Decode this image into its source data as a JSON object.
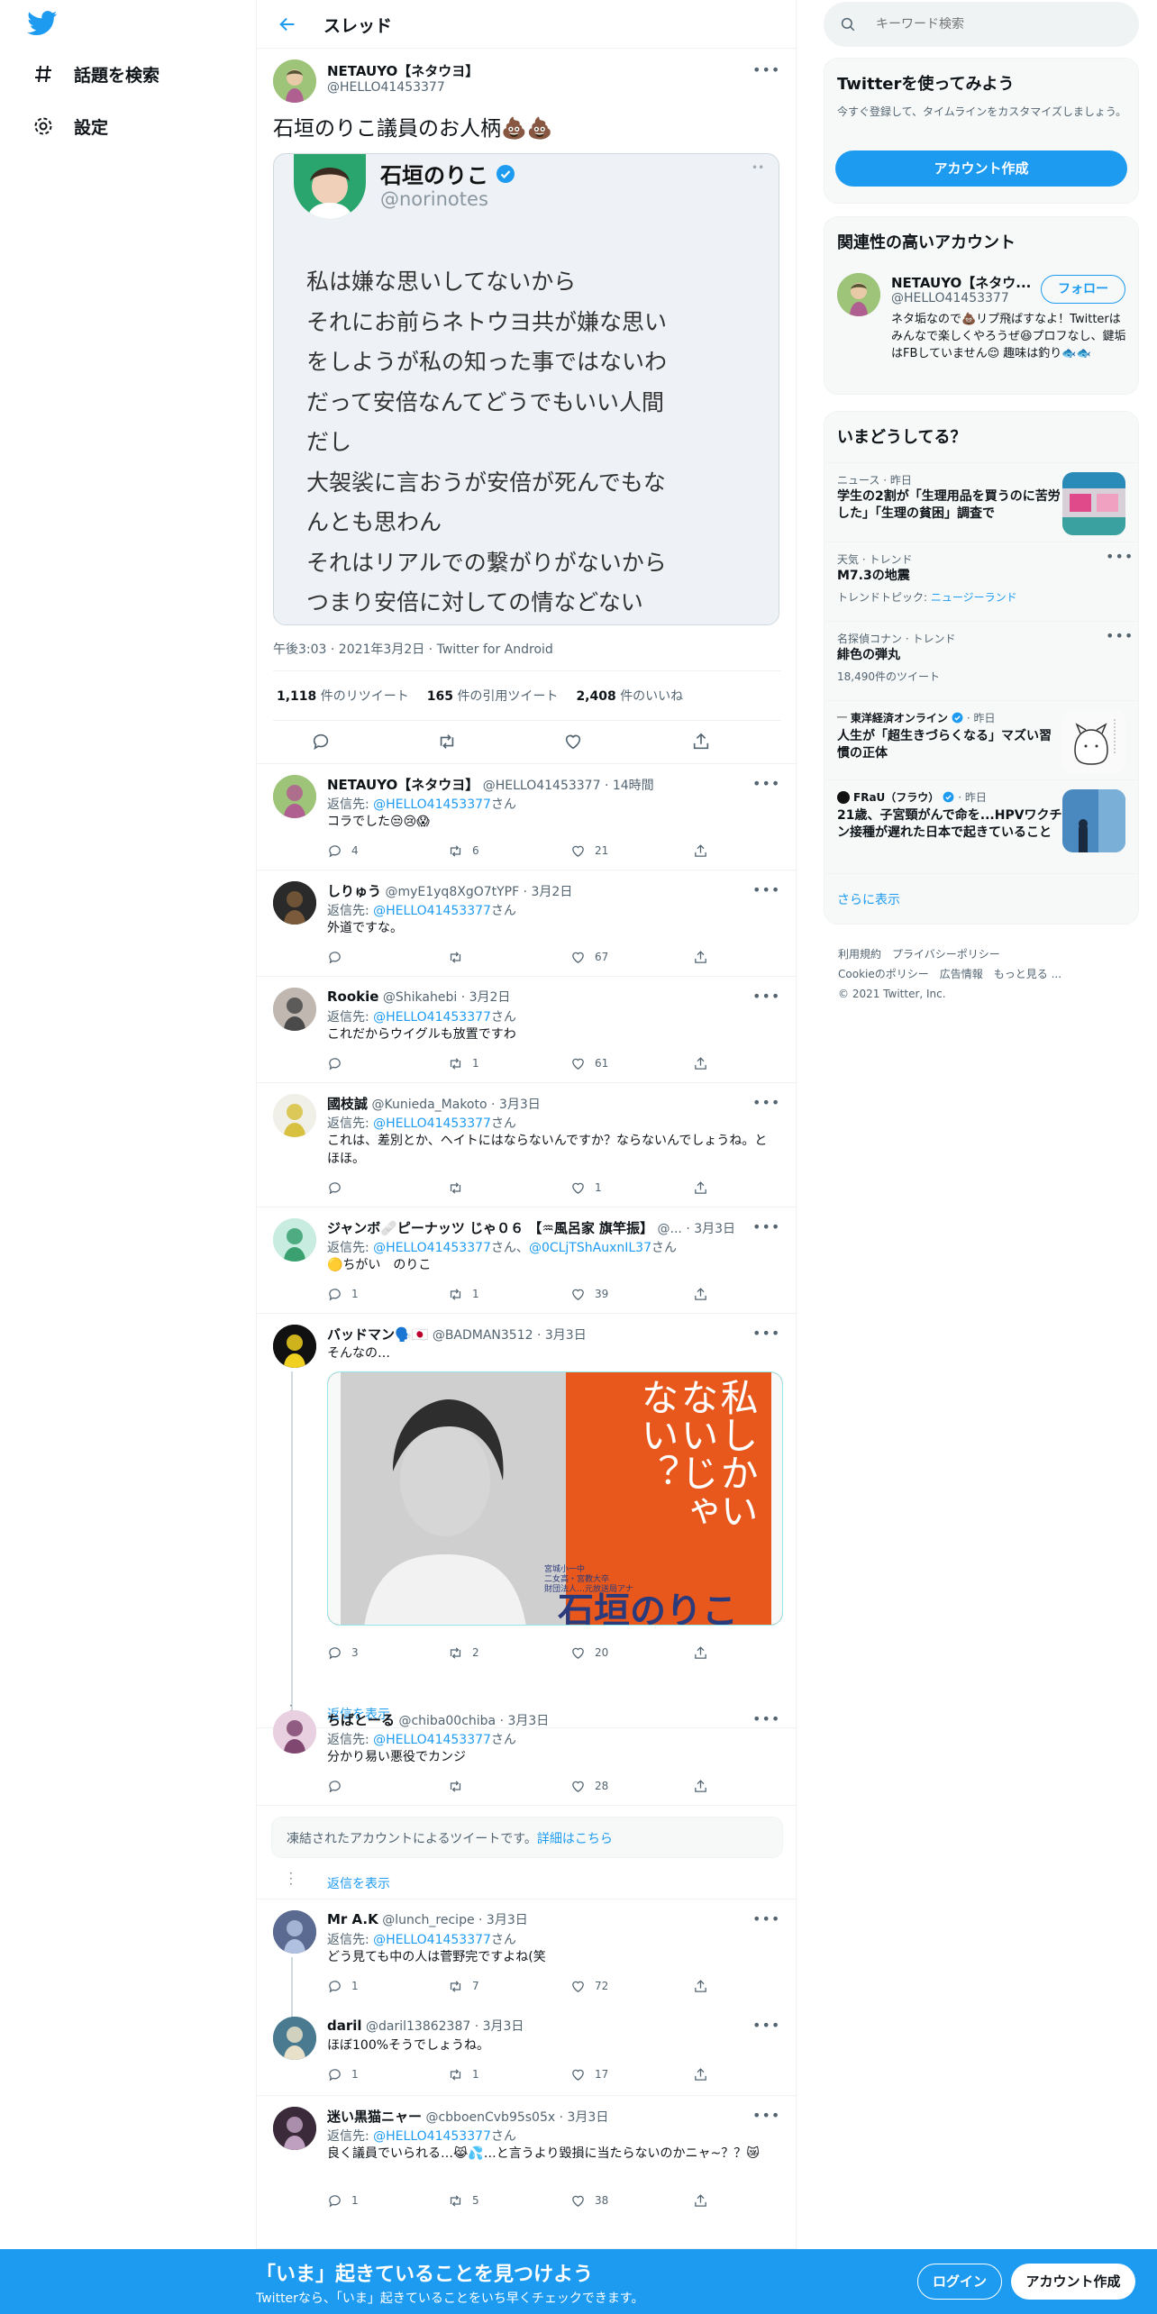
{
  "left_nav": {
    "items": [
      {
        "icon": "hashtag-icon",
        "label": "話題を検索"
      },
      {
        "icon": "gear-icon",
        "label": "設定"
      }
    ]
  },
  "header": {
    "title": "スレッド"
  },
  "main_tweet": {
    "name": "NETAUYO【ネタウヨ】",
    "handle": "@HELLO41453377",
    "text": "石垣のりこ議員のお人柄💩💩",
    "image_card": {
      "name": "石垣のりこ",
      "handle": "@norinotes",
      "lines": [
        "私は嫌な思いしてないから",
        "それにお前らネトウヨ共が嫌な思い",
        "をしようが私の知った事ではないわ",
        "だって安倍なんてどうでもいい人間",
        "だし",
        "大袈裟に言おうが安倍が死んでもな",
        "んとも思わん",
        "それはリアルでの繋がりがないから",
        "つまり安倍に対しての情などない"
      ]
    },
    "meta": "午後3:03 · 2021年3月2日 · Twitter for Android",
    "stats": {
      "retweets": "1,118",
      "retweets_label": "件のリツイート",
      "quotes": "165",
      "quotes_label": "件の引用ツイート",
      "likes": "2,408",
      "likes_label": "件のいいね"
    }
  },
  "replies": [
    {
      "name": "NETAUYO【ネタウヨ】",
      "handle": "@HELLO41453377",
      "time": "· 14時間",
      "reply_to": "@HELLO41453377",
      "reply_prefix": "返信先: ",
      "reply_suffix": "さん",
      "text": "コラでした😒😢😱",
      "counts": {
        "reply": "4",
        "rt": "6",
        "like": "21"
      }
    },
    {
      "name": "しりゅう",
      "handle": "@myE1yq8XgO7tYPF",
      "time": "· 3月2日",
      "reply_to": "@HELLO41453377",
      "reply_prefix": "返信先: ",
      "reply_suffix": "さん",
      "text": "外道ですな。",
      "counts": {
        "reply": "",
        "rt": "",
        "like": "67"
      }
    },
    {
      "name": "Rookie",
      "handle": "@Shikahebi",
      "time": "· 3月2日",
      "reply_to": "@HELLO41453377",
      "reply_prefix": "返信先: ",
      "reply_suffix": "さん",
      "text": "これだからウイグルも放置ですわ",
      "counts": {
        "reply": "",
        "rt": "1",
        "like": "61"
      }
    },
    {
      "name": "國枝誠",
      "handle": "@Kunieda_Makoto",
      "time": "· 3月3日",
      "reply_to": "@HELLO41453377",
      "reply_prefix": "返信先: ",
      "reply_suffix": "さん",
      "text": "これは、差別とか、ヘイトにはならないんですか？ならないんでしょうね。とほほ。",
      "counts": {
        "reply": "",
        "rt": "",
        "like": "1"
      }
    },
    {
      "name": "ジャンボ🩹ピーナッツ じゃ０６ 【♒風呂家 旗竿振】",
      "handle": "@...",
      "time": "· 3月3日",
      "reply_to": "@HELLO41453377",
      "reply_to2": "@0CLjTShAuxnIL37",
      "reply_prefix": "返信先: ",
      "reply_mid": "さん、",
      "reply_suffix": "さん",
      "text": "🟡ちがい　のりこ",
      "counts": {
        "reply": "1",
        "rt": "1",
        "like": "39"
      }
    },
    {
      "name": "バッドマン🗣️🇯🇵",
      "handle": "@BADMAN3512",
      "time": "· 3月3日",
      "text": "そんなの…",
      "image_text": "私しかいないじゃない？",
      "image_name": "石垣のりこ",
      "image_small": [
        "宮城小一中",
        "二女高・宮教大卒",
        "財団法人…元放送局アナ"
      ],
      "counts": {
        "reply": "3",
        "rt": "2",
        "like": "20"
      }
    },
    {
      "name": "ちばとーる",
      "handle": "@chiba00chiba",
      "time": "· 3月3日",
      "reply_to": "@HELLO41453377",
      "reply_prefix": "返信先: ",
      "reply_suffix": "さん",
      "text": "分かり易い悪役でカンジ",
      "counts": {
        "reply": "",
        "rt": "",
        "like": "28"
      }
    },
    {
      "name": "Mr A.K",
      "handle": "@lunch_recipe",
      "time": "· 3月3日",
      "reply_to": "@HELLO41453377",
      "reply_prefix": "返信先: ",
      "reply_suffix": "さん",
      "text": "どう見ても中の人は菅野完ですよね(笑",
      "counts": {
        "reply": "1",
        "rt": "7",
        "like": "72"
      }
    },
    {
      "name": "daril",
      "handle": "@daril13862387",
      "time": "· 3月3日",
      "text": "ほぼ100%そうでしょうね。",
      "counts": {
        "reply": "1",
        "rt": "1",
        "like": "17"
      }
    },
    {
      "name": "迷い黒猫ニャー",
      "handle": "@cbboenCvb95s05x",
      "time": "· 3月3日",
      "reply_to": "@HELLO41453377",
      "reply_prefix": "返信先: ",
      "reply_suffix": "さん",
      "text": "良く議員でいられる…😹💦…と言うより毀損に当たらないのかニャ~？？😿",
      "counts": {
        "reply": "1",
        "rt": "5",
        "like": "38"
      }
    }
  ],
  "show_replies": "返信を表示",
  "frozen_notice": {
    "text": "凍結されたアカウントによるツイートです。",
    "link": "詳細はこちら"
  },
  "right": {
    "search_placeholder": "キーワード検索",
    "signup": {
      "title": "Twitterを使ってみよう",
      "desc": "今すぐ登録して、タイムラインをカスタマイズしましょう。",
      "button": "アカウント作成"
    },
    "related": {
      "title": "関連性の高いアカウント",
      "name": "NETAUYO【ネタウ...",
      "handle": "@HELLO41453377",
      "follow": "フォロー",
      "bio": "ネタ垢なので💩リプ飛ばすなよ！Twitterはみんなで楽しくやろうぜ😆プロフなし、鍵垢はFBしていません😌 趣味は釣り🐟🐟"
    },
    "trends": {
      "title": "いまどうしてる？",
      "items": [
        {
          "cat": "ニュース · 昨日",
          "title": "学生の2割が「生理用品を買うのに苦労した」「生理の貧困」調査で",
          "sub": ""
        },
        {
          "cat": "天気 · トレンド",
          "title": "M7.3の地震",
          "sub": "トレンドトピック: ",
          "sub_link": "ニュージーランド"
        },
        {
          "cat": "名探偵コナン · トレンド",
          "title": "緋色の弾丸",
          "sub": "18,490件のツイート"
        },
        {
          "source": "東洋経済オンライン",
          "cat": "· 昨日",
          "title": "人生が「超生きづらくなる」マズい習慣の正体",
          "sub": ""
        },
        {
          "source": "FRaU（フラウ）",
          "cat": "· 昨日",
          "title": "21歳、子宮頸がんで命を...HPVワクチン接種が遅れた日本で起きていること",
          "sub": ""
        }
      ],
      "more": "さらに表示"
    },
    "footer": {
      "links1": [
        "利用規約",
        "プライバシーポリシー"
      ],
      "links2": [
        "Cookieのポリシー",
        "広告情報",
        "もっと見る ..."
      ],
      "copyright": "© 2021 Twitter, Inc."
    }
  },
  "bottom_bar": {
    "title": "「いま」起きていることを見つけよう",
    "sub": "Twitterなら、「いま」起きていることをいち早くチェックできます。",
    "login": "ログイン",
    "signup": "アカウント作成"
  },
  "colors": {
    "accent": "#1d9bf0",
    "text": "#0f1419",
    "muted": "#536471",
    "border": "#eff3f4",
    "panel": "#f7f9f9"
  }
}
